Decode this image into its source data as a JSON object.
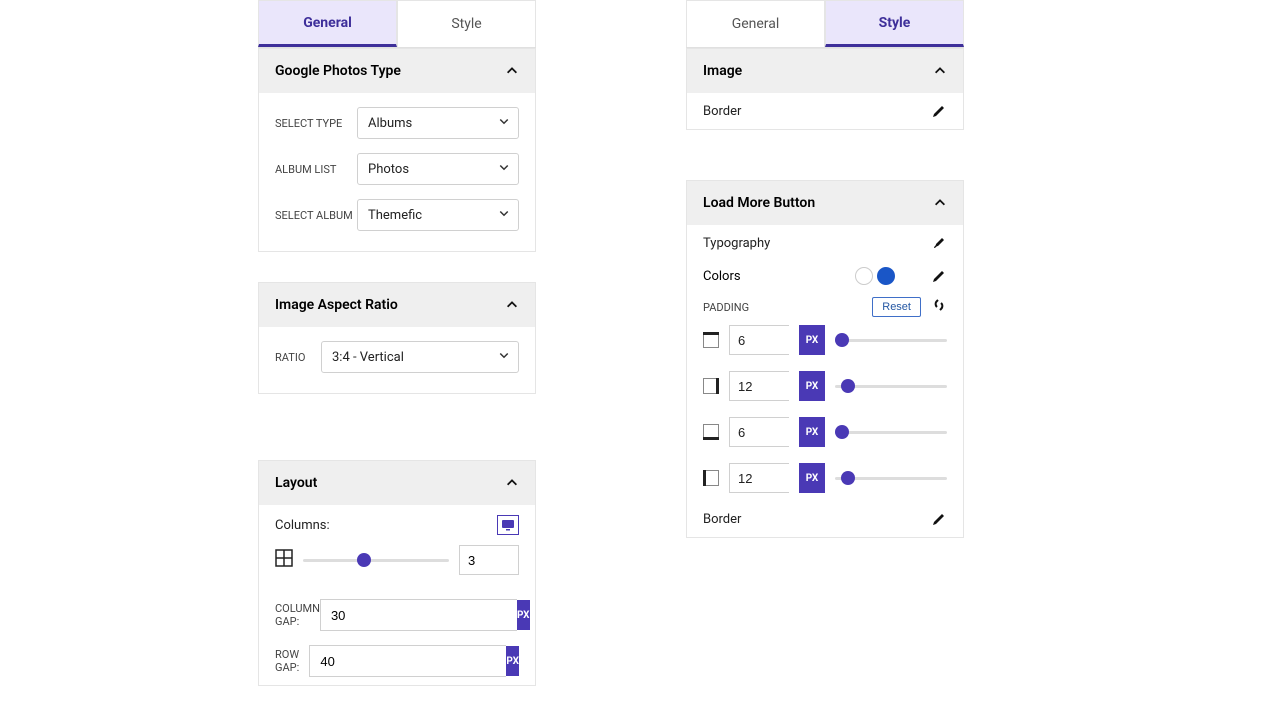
{
  "tabs": {
    "general": "General",
    "style": "Style"
  },
  "gphotos": {
    "title": "Google Photos Type",
    "select_type_label": "Select Type",
    "select_type_value": "Albums",
    "album_list_label": "Album List",
    "album_list_value": "Photos",
    "select_album_label": "Select Album",
    "select_album_value": "Themefic"
  },
  "aspect": {
    "title": "Image Aspect Ratio",
    "ratio_label": "Ratio",
    "ratio_value": "3:4 - Vertical"
  },
  "layout": {
    "title": "Layout",
    "columns_label": "Columns:",
    "columns_value": "3",
    "columns_percent": 42,
    "column_gap_label": "Column Gap:",
    "column_gap_value": "30",
    "row_gap_label": "Row Gap:",
    "row_gap_value": "40",
    "unit": "PX"
  },
  "image": {
    "title": "Image",
    "border_label": "Border"
  },
  "loadmore": {
    "title": "Load More Button",
    "typography_label": "Typography",
    "colors_label": "Colors",
    "padding_label": "Padding",
    "reset_label": "Reset",
    "unit": "PX",
    "border_label": "Border",
    "pads": [
      {
        "side": "top",
        "value": "6",
        "percent": 6
      },
      {
        "side": "right",
        "value": "12",
        "percent": 12
      },
      {
        "side": "bottom",
        "value": "6",
        "percent": 6
      },
      {
        "side": "left",
        "value": "12",
        "percent": 12
      }
    ]
  }
}
